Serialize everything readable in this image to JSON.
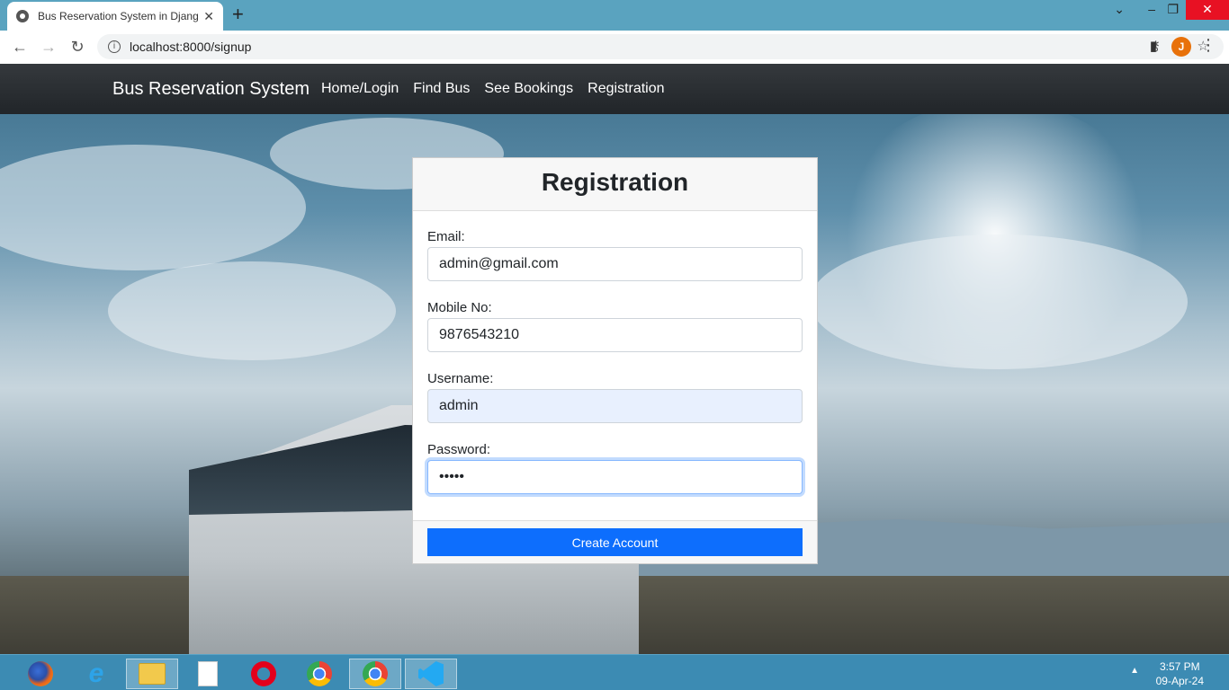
{
  "browser": {
    "tab_title": "Bus Reservation System in Djang",
    "tab_close": "✕",
    "new_tab": "+",
    "url": "localhost:8000/signup",
    "profile_initial": "J",
    "window_controls": {
      "dropdown": "⌄",
      "minimize": "–",
      "restore": "❐",
      "close": "✕"
    }
  },
  "navbar": {
    "brand": "Bus Reservation System",
    "links": [
      "Home/Login",
      "Find Bus",
      "See Bookings",
      "Registration"
    ]
  },
  "form": {
    "title": "Registration",
    "fields": [
      {
        "label": "Email:",
        "value": "admin@gmail.com"
      },
      {
        "label": "Mobile No:",
        "value": "9876543210"
      },
      {
        "label": "Username:",
        "value": "admin"
      },
      {
        "label": "Password:",
        "value": "•••••"
      }
    ],
    "submit_label": "Create Account"
  },
  "taskbar": {
    "time": "3:57 PM",
    "date": "09-Apr-24",
    "apps": [
      "firefox-icon",
      "ie-icon",
      "file-explorer-icon",
      "document-icon",
      "opera-icon",
      "chrome-icon",
      "chrome-active-icon",
      "vscode-icon"
    ]
  },
  "colors": {
    "navbar_bg": "#212529",
    "primary": "#0d6efd",
    "autofill_bg": "#e8f0fe",
    "close_red": "#e81123"
  }
}
